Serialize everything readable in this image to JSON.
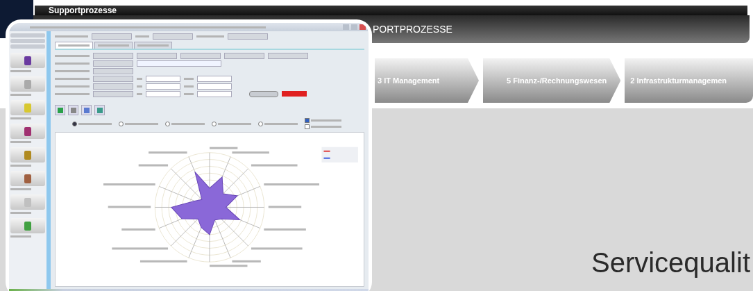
{
  "top_bar": {
    "title": "Supportprozesse"
  },
  "header": {
    "title": "PORTPROZESSE"
  },
  "process_steps": [
    {
      "label": "3 IT Management"
    },
    {
      "label": "5 Finanz-/Rechnungswesen"
    },
    {
      "label": "2 Infrastrukturmanagemen"
    }
  ],
  "headline": "Servicequalit",
  "inset_window": {
    "tabs": [
      {
        "selected": true
      },
      {
        "selected": false
      },
      {
        "selected": false
      }
    ],
    "chart_types": [
      {
        "selected": true
      },
      {
        "selected": false
      },
      {
        "selected": false
      },
      {
        "selected": false
      },
      {
        "selected": false
      }
    ],
    "options": [
      {
        "checked": true
      },
      {
        "checked": false
      }
    ]
  }
}
